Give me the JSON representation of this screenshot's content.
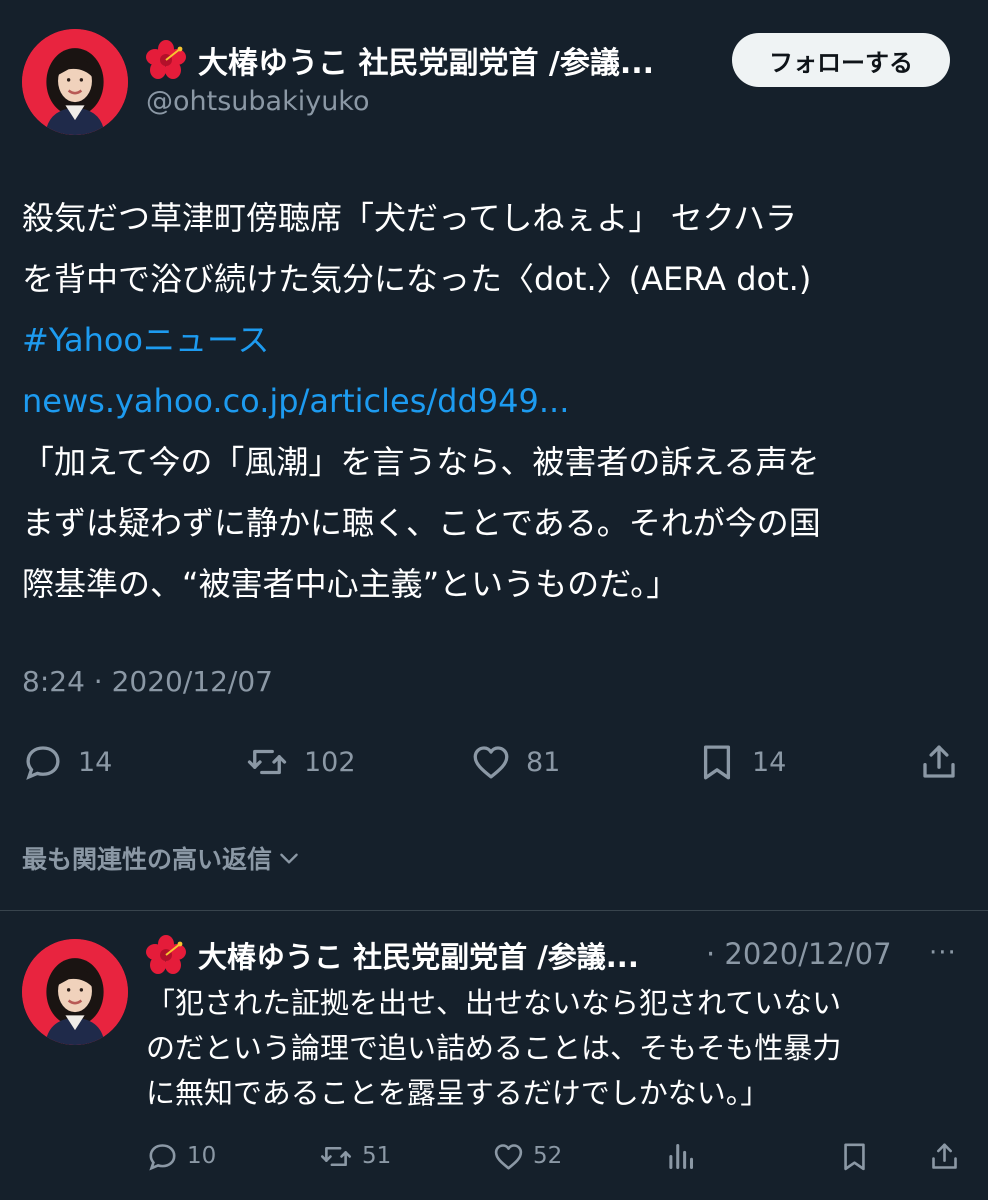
{
  "tweet": {
    "author": {
      "display_name": "大椿ゆうこ 社民党副党首 /参議...",
      "handle": "@ohtsubakiyuko",
      "avatar_icon": "profile-photo",
      "name_emoji_icon": "hibiscus-icon"
    },
    "follow_label": "フォローする",
    "text_lines": [
      "殺気だつ草津町傍聴席「犬だってしねぇよ」 セクハラ",
      "を背中で浴び続けた気分になった〈dot.〉(AERA dot.)"
    ],
    "hashtag": "#Yahooニュース",
    "link": "news.yahoo.co.jp/articles/dd949...",
    "quote_lines": [
      "「加えて今の「風潮」を言うなら、被害者の訴える声を",
      "まずは疑わずに静かに聴く、ことである。それが今の国",
      "際基準の、“被害者中心主義”というものだ。」"
    ],
    "timestamp": "8:24 · 2020/12/07",
    "actions": {
      "replies": "14",
      "retweets": "102",
      "likes": "81",
      "bookmarks": "14"
    }
  },
  "relevance_label": "最も関連性の高い返信",
  "reply": {
    "display_name": "大椿ゆうこ 社民党副党首 /参議...",
    "date": "· 2020/12/07",
    "more_label": "···",
    "text_lines": [
      "「犯された証拠を出せ、出せないなら犯されていない",
      "のだという論理で追い詰めることは、そもそも性暴力",
      "に無知であることを露呈するだけでしかない。」"
    ],
    "actions": {
      "replies": "10",
      "retweets": "51",
      "likes": "52"
    }
  },
  "colors": {
    "background": "#15202b",
    "link": "#1d9bf0",
    "secondary_text": "#8b98a5",
    "avatar_ring": "#e8243f"
  }
}
